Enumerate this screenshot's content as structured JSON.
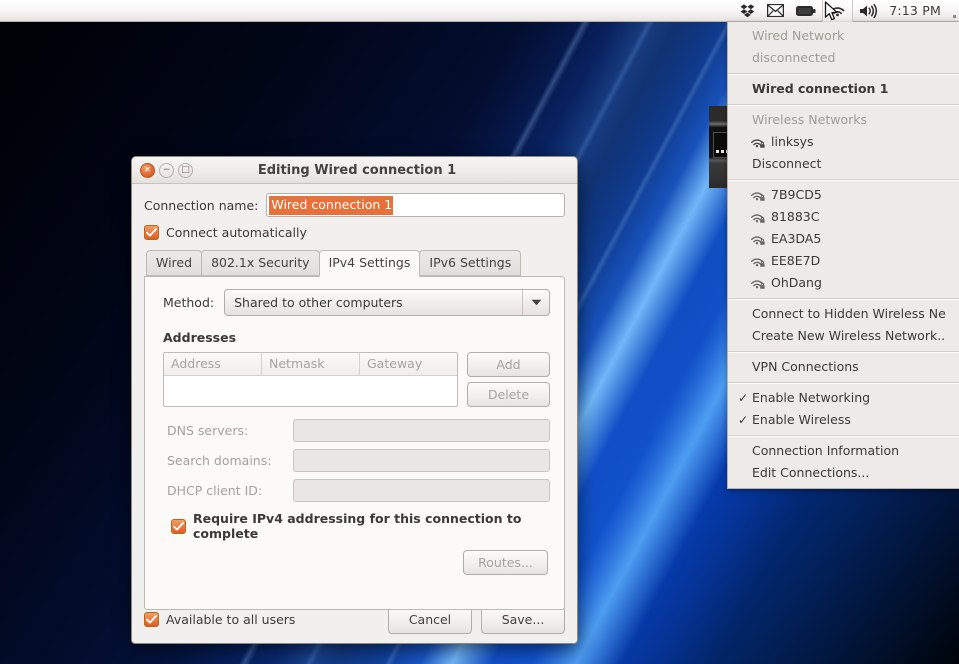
{
  "panel": {
    "clock": "7:13 PM",
    "tray": [
      {
        "icon": "dropbox-icon",
        "name": "dropbox"
      },
      {
        "icon": "envelope-icon",
        "name": "messaging"
      },
      {
        "icon": "battery-icon",
        "name": "battery"
      },
      {
        "icon": "wireless-icon",
        "name": "network"
      },
      {
        "icon": "volume-icon",
        "name": "sound"
      }
    ]
  },
  "network_menu": {
    "wired_section_label": "Wired Network",
    "wired_status": "disconnected",
    "wired_connection": "Wired connection 1",
    "wireless_section_label": "Wireless Networks",
    "active_network": "linksys",
    "disconnect_label": "Disconnect",
    "access_points": [
      {
        "ssid": "7B9CD5",
        "icon": "wifi-secured-icon"
      },
      {
        "ssid": "81883C",
        "icon": "wifi-secured-icon"
      },
      {
        "ssid": "EA3DA5",
        "icon": "wifi-secured-icon"
      },
      {
        "ssid": "EE8E7D",
        "icon": "wifi-secured-icon"
      },
      {
        "ssid": "OhDang",
        "icon": "wifi-secured-icon"
      }
    ],
    "connect_hidden": "Connect to Hidden Wireless Ne",
    "create_new": "Create New Wireless Network..",
    "vpn_connections": "VPN Connections",
    "enable_networking": "Enable Networking",
    "enable_wireless": "Enable Wireless",
    "connection_information": "Connection Information",
    "edit_connections": "Edit Connections...",
    "checkmark": "✓"
  },
  "dialog": {
    "title": "Editing Wired connection 1",
    "connection_name_label": "Connection name:",
    "connection_name_value": "Wired connection 1",
    "connect_automatically_label": "Connect automatically",
    "tabs": [
      {
        "label": "Wired",
        "active": false
      },
      {
        "label": "802.1x Security",
        "active": false
      },
      {
        "label": "IPv4 Settings",
        "active": true
      },
      {
        "label": "IPv6 Settings",
        "active": false
      }
    ],
    "method_label": "Method:",
    "method_value": "Shared to other computers",
    "addresses_title": "Addresses",
    "address_columns": [
      "Address",
      "Netmask",
      "Gateway"
    ],
    "address_rows": [],
    "add_label": "Add",
    "delete_label": "Delete",
    "dns_label": "DNS servers:",
    "dns_value": "",
    "search_domains_label": "Search domains:",
    "search_domains_value": "",
    "dhcp_label": "DHCP client ID:",
    "dhcp_value": "",
    "require_ipv4_label": "Require IPv4 addressing for this connection to complete",
    "routes_label": "Routes...",
    "available_all_users_label": "Available to all users",
    "cancel_label": "Cancel",
    "save_label": "Save...",
    "window_buttons": {
      "close": "×",
      "minimize": "−",
      "maximize": "□"
    }
  },
  "colors": {
    "accent_orange": "#dd5f22",
    "selection_orange": "#e8703a",
    "panel_bg": "#efeceb",
    "menu_bg": "#edeae7",
    "dialog_bg": "#f2f0ee"
  }
}
